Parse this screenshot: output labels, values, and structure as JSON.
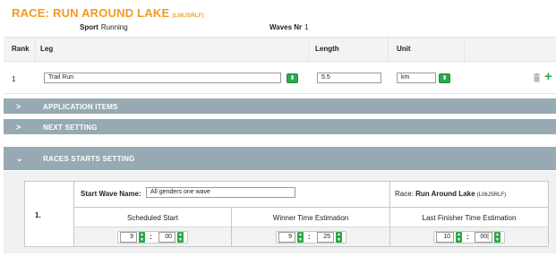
{
  "header": {
    "title": "RACE: RUN AROUND LAKE",
    "code": "(L06JSRLF)",
    "sport_label": "Sport",
    "sport_value": "Running",
    "waves_label": "Waves Nr",
    "waves_value": "1"
  },
  "legs": {
    "columns": [
      "Rank",
      "Leg",
      "Length",
      "Unit"
    ],
    "rows": [
      {
        "rank": "1",
        "leg": "Trail Run",
        "length": "5.5",
        "unit": "km"
      }
    ],
    "icons": [
      "chevron-updown-icon",
      "trash-icon",
      "plus-icon"
    ]
  },
  "sections": {
    "application_items": "APPLICATION ITEMS",
    "next_setting": "NEXT SETTING",
    "races_starts_setting": "RACES STARTS SETTING"
  },
  "races_starts": {
    "row_number": "1.",
    "start_wave_label": "Start Wave Name:",
    "start_wave_value": "All genders one wave",
    "race_label": "Race:",
    "race_name": "Run Around Lake",
    "race_code": "(L06JSRLF)",
    "scheduled_start_label": "Scheduled Start",
    "winner_time_label": "Winner Time Estimation",
    "last_finisher_label": "Last Finisher Time Estimation",
    "scheduled_start": {
      "hours": "9",
      "minutes": "00"
    },
    "winner_time": {
      "hours": "9",
      "minutes": "25"
    },
    "last_finisher": {
      "hours": "10",
      "minutes": "00|"
    },
    "separator": ":"
  },
  "colors": {
    "accent_orange": "#f39a1e",
    "section_bar": "#97a9b3",
    "spinner_green": "#2ba94a"
  }
}
